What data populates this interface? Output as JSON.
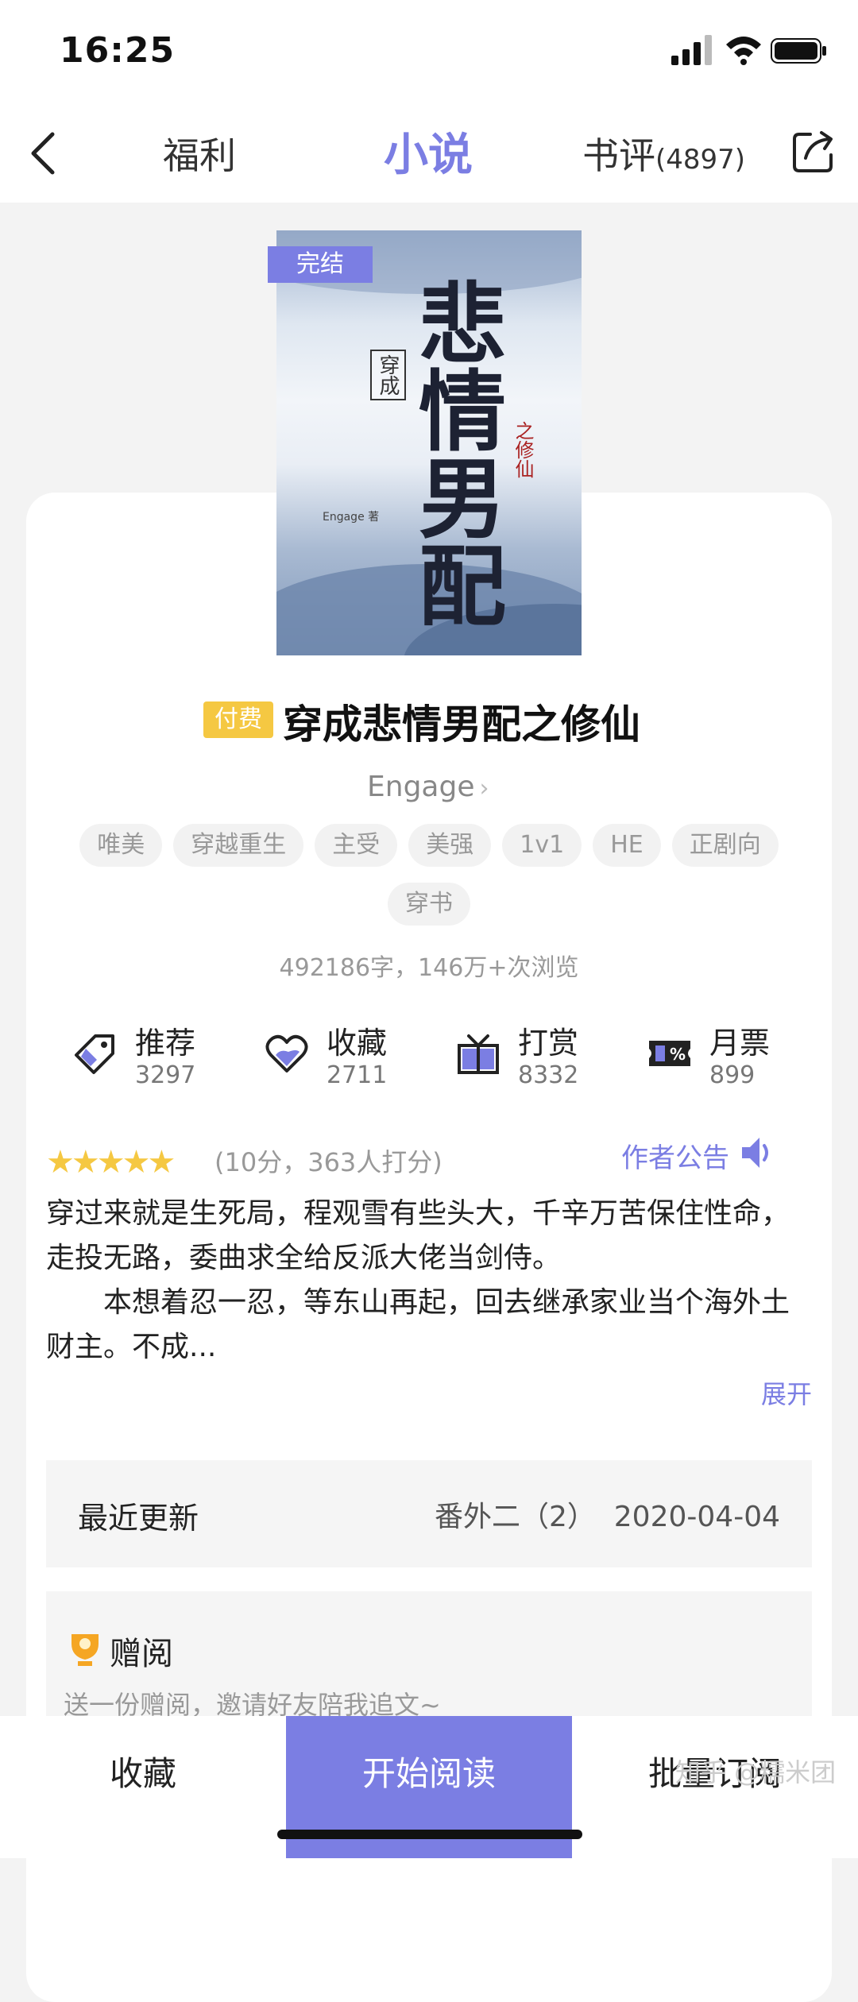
{
  "status": {
    "time": "16:25"
  },
  "nav": {
    "tabs": [
      {
        "label": "福利"
      },
      {
        "label": "小说"
      },
      {
        "label": "书评",
        "count": "(4897)"
      }
    ]
  },
  "book": {
    "status_badge": "完结",
    "cover": {
      "title_art": "悲情男配",
      "tag": "穿成",
      "subtitle": "之修仙",
      "author_small": "Engage 著"
    },
    "paid_badge": "付费",
    "title": "穿成悲情男配之修仙",
    "author": "Engage",
    "tags": [
      "唯美",
      "穿越重生",
      "主受",
      "美强",
      "1v1",
      "HE",
      "正剧向",
      "穿书"
    ],
    "stats": "492186字，146万+次浏览"
  },
  "actions": [
    {
      "label": "推荐",
      "count": "3297",
      "icon": "tag-icon"
    },
    {
      "label": "收藏",
      "count": "2711",
      "icon": "heart-icon"
    },
    {
      "label": "打赏",
      "count": "8332",
      "icon": "gift-icon"
    },
    {
      "label": "月票",
      "count": "899",
      "icon": "ticket-icon"
    }
  ],
  "rating": {
    "stars": 5,
    "text": "(10分，363人打分)"
  },
  "notice_label": "作者公告",
  "description": {
    "p1": "穿过来就是生死局，程观雪有些头大，千辛万苦保住性命，走投无路，委曲求全给反派大佬当剑侍。",
    "p2": "本想着忍一忍，等东山再起，回去继承家业当个海外土财主。不成..."
  },
  "expand_label": "展开",
  "recent_update": {
    "label": "最近更新",
    "chapter": "番外二（2）",
    "date": "2020-04-04"
  },
  "gift": {
    "title": "赠阅",
    "subtitle": "送一份赠阅，邀请好友陪我追文~"
  },
  "bottom": {
    "collect": "收藏",
    "start_read": "开始阅读",
    "batch_subscribe": "批量订阅"
  },
  "watermark": "知乎 @糯米团",
  "colors": {
    "accent": "#7b7ee3",
    "paid": "#f5c842",
    "star": "#f5c842"
  }
}
